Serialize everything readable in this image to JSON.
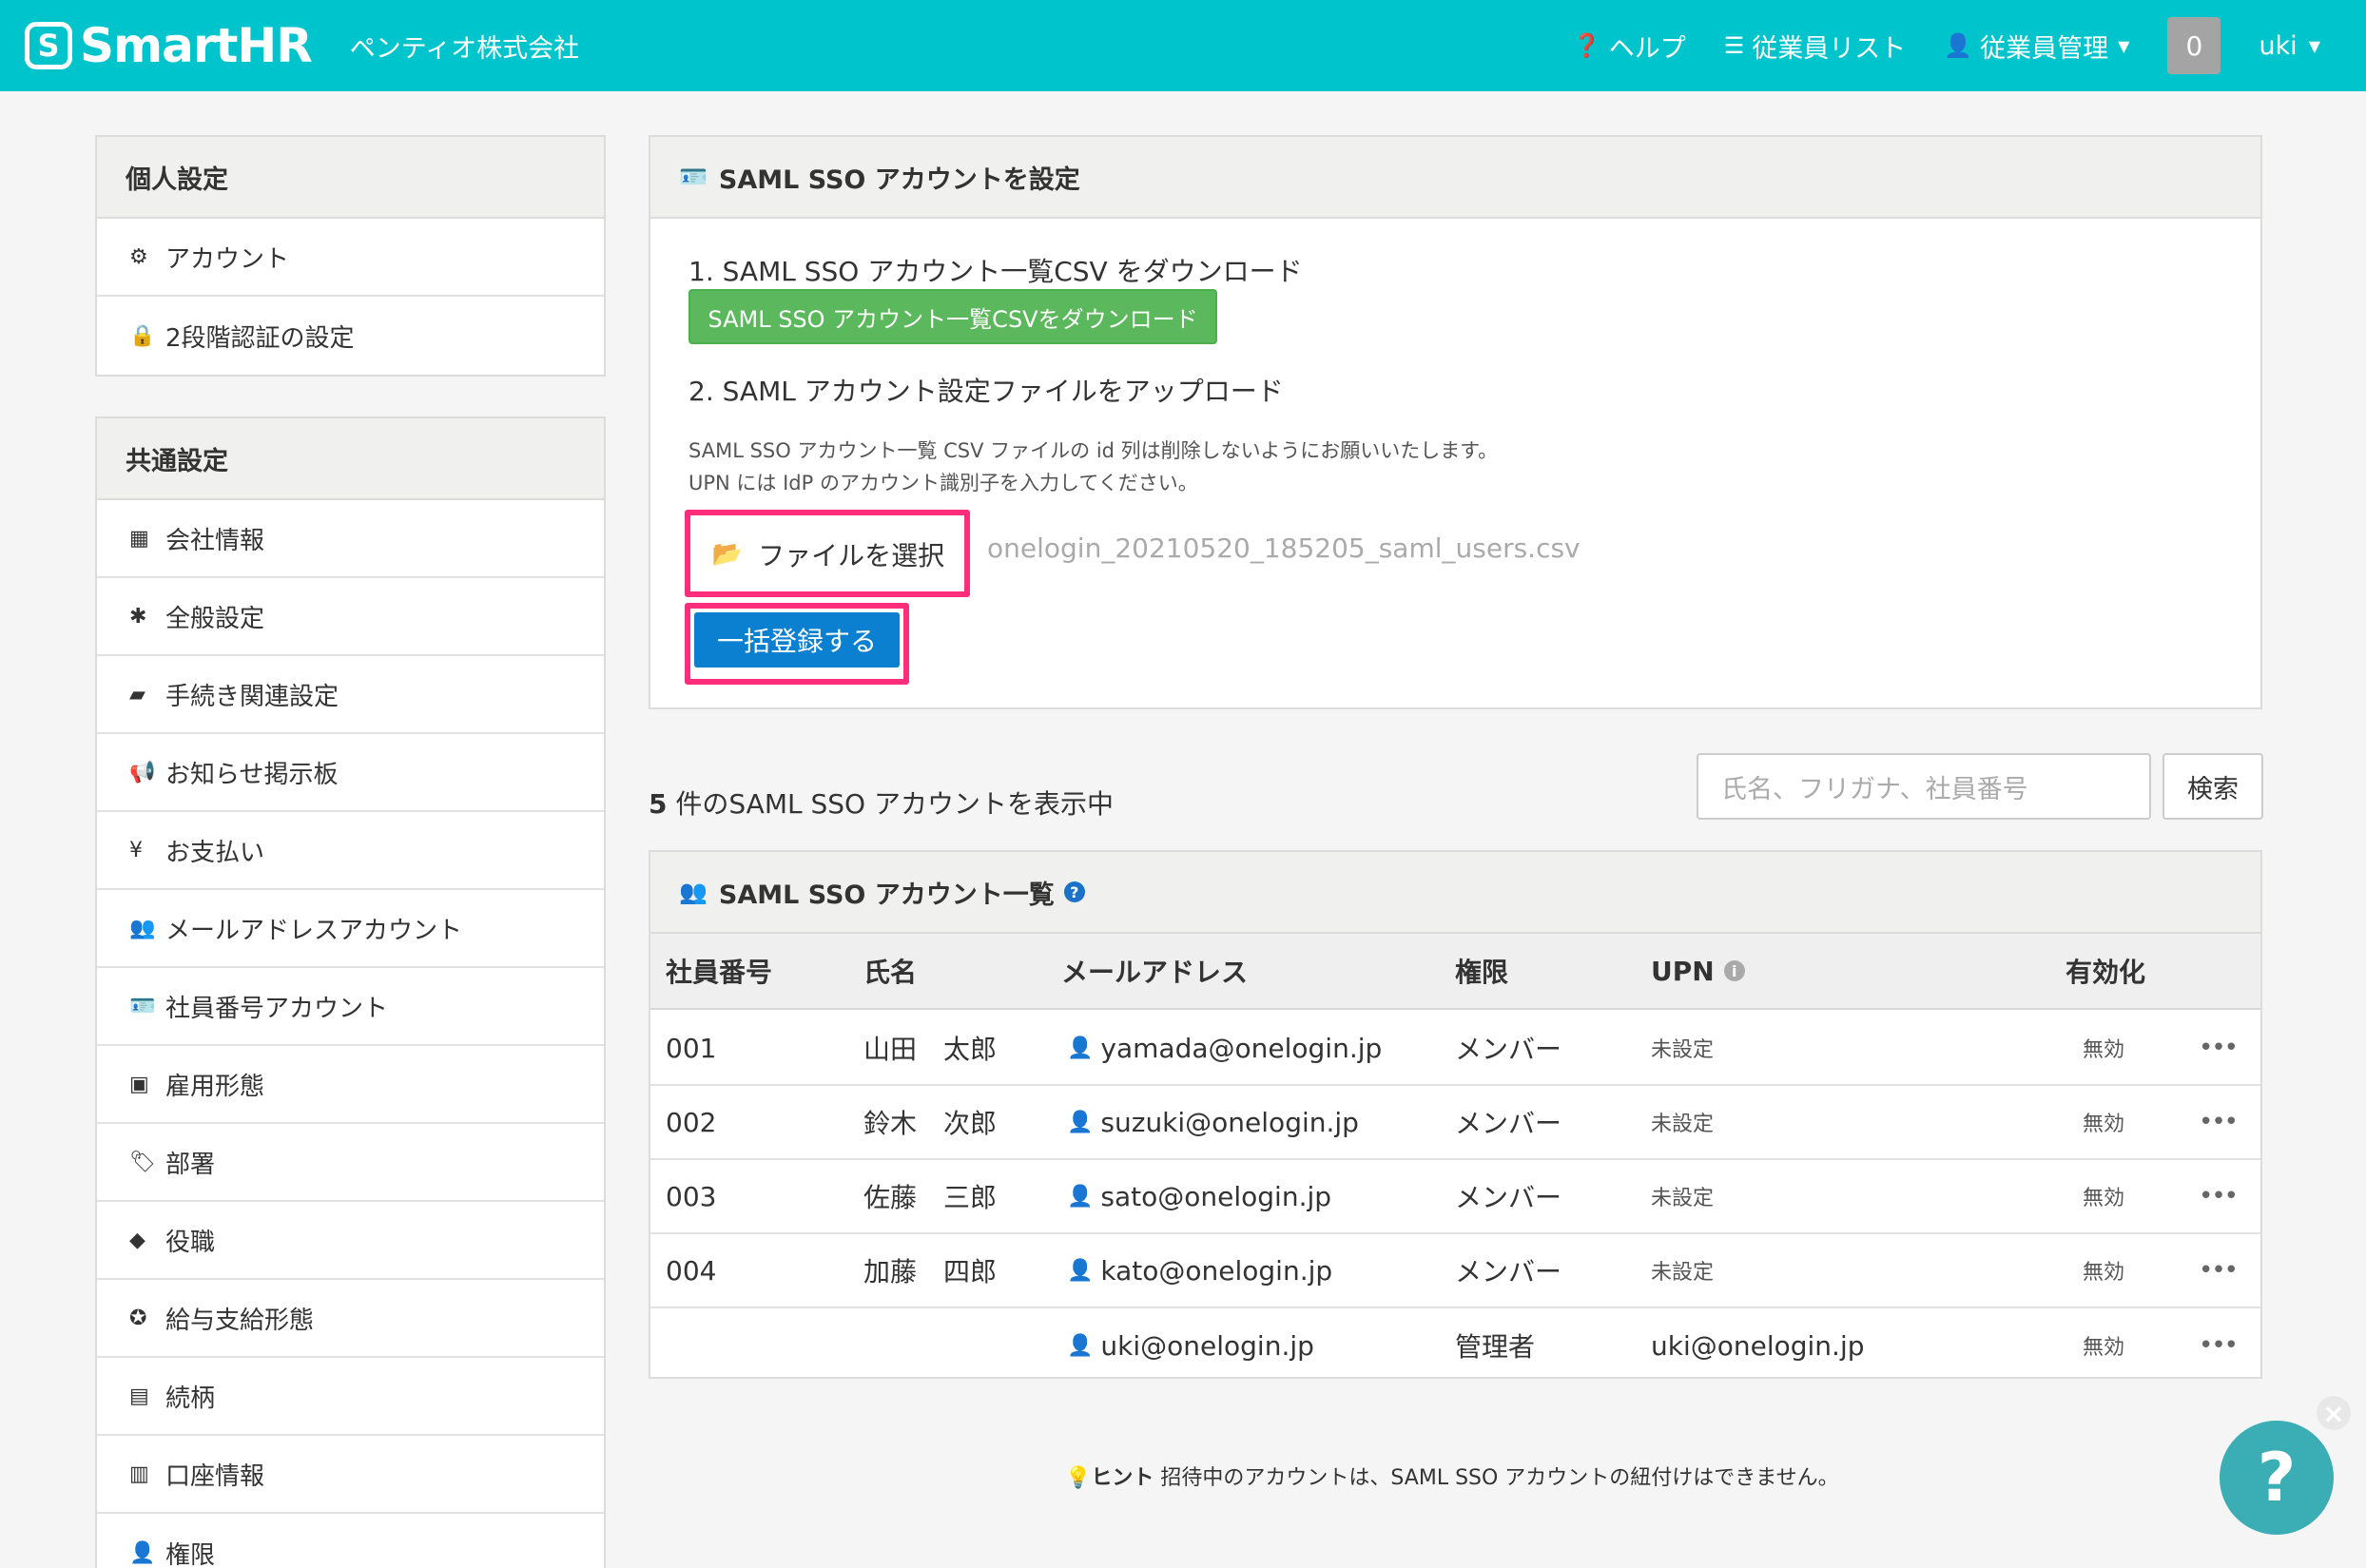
{
  "header": {
    "logo_text": "SmartHR",
    "logo_mark": "S",
    "company": "ペンティオ株式会社",
    "help": "ヘルプ",
    "employee_list": "従業員リスト",
    "employee_mgmt": "従業員管理",
    "notification_count": "0",
    "user": "uki",
    "color": "#00c4cc"
  },
  "sidebar": {
    "personal": {
      "title": "個人設定",
      "items": [
        {
          "label": "アカウント",
          "icon": "gear-icon"
        },
        {
          "label": "2段階認証の設定",
          "icon": "lock-icon"
        }
      ]
    },
    "common": {
      "title": "共通設定",
      "items": [
        {
          "label": "会社情報",
          "icon": "building-icon"
        },
        {
          "label": "全般設定",
          "icon": "asterisk-icon"
        },
        {
          "label": "手続き関連設定",
          "icon": "book-icon"
        },
        {
          "label": "お知らせ掲示板",
          "icon": "megaphone-icon"
        },
        {
          "label": "お支払い",
          "icon": "yen-icon"
        },
        {
          "label": "メールアドレスアカウント",
          "icon": "users-icon"
        },
        {
          "label": "社員番号アカウント",
          "icon": "id-card-icon"
        },
        {
          "label": "雇用形態",
          "icon": "badge-icon"
        },
        {
          "label": "部署",
          "icon": "tags-icon"
        },
        {
          "label": "役職",
          "icon": "tag-icon"
        },
        {
          "label": "給与支給形態",
          "icon": "certificate-icon"
        },
        {
          "label": "続柄",
          "icon": "portrait-icon"
        },
        {
          "label": "口座情報",
          "icon": "list-alt-icon"
        },
        {
          "label": "権限",
          "icon": "user-shield-icon"
        }
      ]
    }
  },
  "upload_card": {
    "title": "SAML SSO アカウントを設定",
    "step1": "1. SAML SSO アカウント一覧CSV をダウンロード",
    "download_button": "SAML SSO アカウント一覧CSVをダウンロード",
    "step2": "2. SAML アカウント設定ファイルをアップロード",
    "note1": "SAML SSO アカウント一覧 CSV ファイルの id 列は削除しないようにお願いいたします。",
    "note2": "UPN には IdP のアカウント識別子を入力してください。",
    "file_button": "ファイルを選択",
    "file_name": "onelogin_20210520_185205_saml_users.csv",
    "submit_button": "一括登録する"
  },
  "list": {
    "count": "5",
    "count_suffix": " 件のSAML SSO アカウントを表示中",
    "search_placeholder": "氏名、フリガナ、社員番号",
    "search_button": "検索",
    "title": "SAML SSO アカウント一覧",
    "columns": [
      "社員番号",
      "氏名",
      "メールアドレス",
      "権限",
      "UPN",
      "有効化"
    ],
    "rows": [
      {
        "emp_no": "001",
        "name": "山田　太郎",
        "email": "yamada@onelogin.jp",
        "role": "メンバー",
        "upn": "未設定",
        "status": "無効"
      },
      {
        "emp_no": "002",
        "name": "鈴木　次郎",
        "email": "suzuki@onelogin.jp",
        "role": "メンバー",
        "upn": "未設定",
        "status": "無効"
      },
      {
        "emp_no": "003",
        "name": "佐藤　三郎",
        "email": "sato@onelogin.jp",
        "role": "メンバー",
        "upn": "未設定",
        "status": "無効"
      },
      {
        "emp_no": "004",
        "name": "加藤　四郎",
        "email": "kato@onelogin.jp",
        "role": "メンバー",
        "upn": "未設定",
        "status": "無効"
      },
      {
        "emp_no": "",
        "name": "",
        "email": "uki@onelogin.jp",
        "role": "管理者",
        "upn": "uki@onelogin.jp",
        "status": "無効"
      }
    ],
    "more_label": "•••"
  },
  "hint": {
    "label": "ヒント",
    "text": " 招待中のアカウントは、SAML SSO アカウントの紐付けはできません。"
  },
  "help_fab": "?",
  "help_close": "×"
}
